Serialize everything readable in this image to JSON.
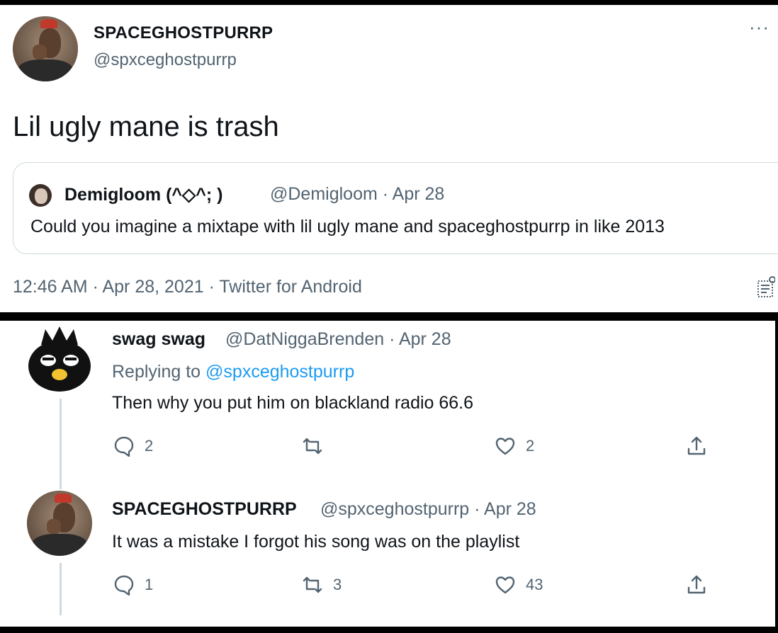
{
  "main_tweet": {
    "display_name": "SPACEGHOSTPURRP",
    "handle": "@spxceghostpurrp",
    "text": "Lil ugly mane is trash",
    "more_icon": "more-dots-icon",
    "quoted": {
      "display_name": "Demigloom (^◇^; )",
      "handle_date": "@Demigloom · Apr 28",
      "text": "Could you imagine a mixtape with lil ugly mane and spaceghostpurrp in like 2013"
    },
    "meta": "12:46 AM · Apr 28, 2021 · Twitter for Android"
  },
  "replies": [
    {
      "display_name": "swag swag",
      "handle_date": "@DatNiggaBrenden · Apr 28",
      "replying_prefix": "Replying to ",
      "replying_to": "@spxceghostpurrp",
      "text": "Then why you put him on blackland radio 66.6",
      "reply_count": "2",
      "retweet_count": "",
      "like_count": "2"
    },
    {
      "display_name": "SPACEGHOSTPURRP",
      "handle_date": "@spxceghostpurrp · Apr 28",
      "text": "It was a mistake I forgot his song was on the playlist",
      "reply_count": "1",
      "retweet_count": "3",
      "like_count": "43"
    }
  ],
  "colors": {
    "accent": "#1d9bf0",
    "muted": "#536471",
    "text": "#0f1419",
    "border": "#cfd9de"
  }
}
